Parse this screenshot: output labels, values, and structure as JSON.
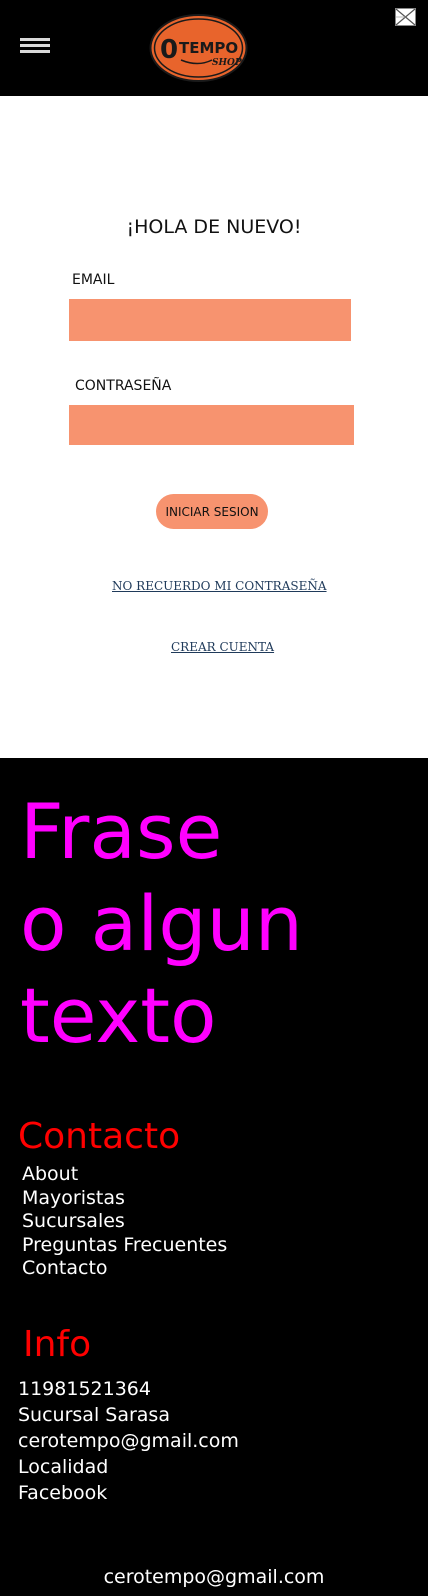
{
  "header": {
    "logo": {
      "text_main": "TEMPO",
      "text_zero": "0",
      "text_sub": "SHOP"
    },
    "menu_icon": "hamburger-menu-icon",
    "close_icon": "broken-image-close-icon"
  },
  "login": {
    "title": "¡HOLA DE NUEVO!",
    "email_label": "EMAIL",
    "email_value": "",
    "password_label": "CONTRASEÑA",
    "password_value": "",
    "submit_label": "INICIAR SESION",
    "forgot_link": "NO RECUERDO MI CONTRASEÑA",
    "create_link": "CREAR CUENTA"
  },
  "footer": {
    "phrase_lines": [
      "Frase",
      "o algun",
      "texto"
    ],
    "contact_heading": "Contacto",
    "contact_items": [
      "About",
      "Mayoristas",
      "Sucursales",
      "Preguntas Frecuentes",
      "Contacto"
    ],
    "info_heading": "Info",
    "info_items": [
      "11981521364",
      "Sucursal Sarasa",
      "cerotempo@gmail.com",
      "Localidad",
      "Facebook"
    ],
    "bottom_email": "cerotempo@gmail.com"
  },
  "colors": {
    "accent_salmon": "#f7936f",
    "phrase_magenta": "#ff00ff",
    "heading_red": "#ff0000",
    "link_blue": "#1f3a5a",
    "logo_orange": "#e8642c"
  }
}
